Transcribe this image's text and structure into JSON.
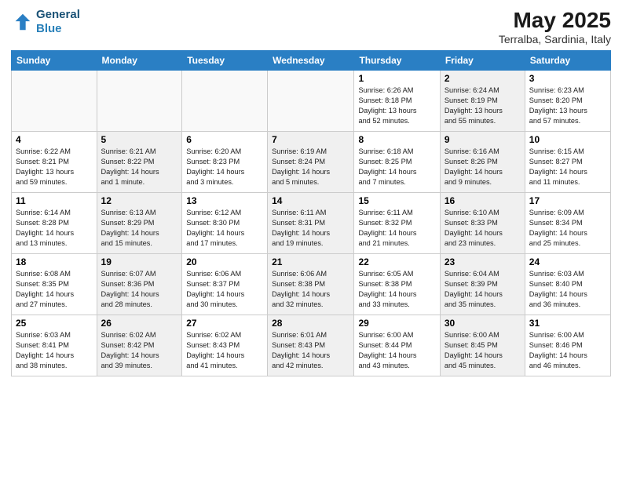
{
  "header": {
    "logo_line1": "General",
    "logo_line2": "Blue",
    "title": "May 2025",
    "subtitle": "Terralba, Sardinia, Italy"
  },
  "days_of_week": [
    "Sunday",
    "Monday",
    "Tuesday",
    "Wednesday",
    "Thursday",
    "Friday",
    "Saturday"
  ],
  "weeks": [
    [
      {
        "day": "",
        "text": "",
        "empty": true
      },
      {
        "day": "",
        "text": "",
        "empty": true
      },
      {
        "day": "",
        "text": "",
        "empty": true
      },
      {
        "day": "",
        "text": "",
        "empty": true
      },
      {
        "day": "1",
        "text": "Sunrise: 6:26 AM\nSunset: 8:18 PM\nDaylight: 13 hours\nand 52 minutes.",
        "shaded": false
      },
      {
        "day": "2",
        "text": "Sunrise: 6:24 AM\nSunset: 8:19 PM\nDaylight: 13 hours\nand 55 minutes.",
        "shaded": true
      },
      {
        "day": "3",
        "text": "Sunrise: 6:23 AM\nSunset: 8:20 PM\nDaylight: 13 hours\nand 57 minutes.",
        "shaded": false
      }
    ],
    [
      {
        "day": "4",
        "text": "Sunrise: 6:22 AM\nSunset: 8:21 PM\nDaylight: 13 hours\nand 59 minutes.",
        "shaded": false
      },
      {
        "day": "5",
        "text": "Sunrise: 6:21 AM\nSunset: 8:22 PM\nDaylight: 14 hours\nand 1 minute.",
        "shaded": true
      },
      {
        "day": "6",
        "text": "Sunrise: 6:20 AM\nSunset: 8:23 PM\nDaylight: 14 hours\nand 3 minutes.",
        "shaded": false
      },
      {
        "day": "7",
        "text": "Sunrise: 6:19 AM\nSunset: 8:24 PM\nDaylight: 14 hours\nand 5 minutes.",
        "shaded": true
      },
      {
        "day": "8",
        "text": "Sunrise: 6:18 AM\nSunset: 8:25 PM\nDaylight: 14 hours\nand 7 minutes.",
        "shaded": false
      },
      {
        "day": "9",
        "text": "Sunrise: 6:16 AM\nSunset: 8:26 PM\nDaylight: 14 hours\nand 9 minutes.",
        "shaded": true
      },
      {
        "day": "10",
        "text": "Sunrise: 6:15 AM\nSunset: 8:27 PM\nDaylight: 14 hours\nand 11 minutes.",
        "shaded": false
      }
    ],
    [
      {
        "day": "11",
        "text": "Sunrise: 6:14 AM\nSunset: 8:28 PM\nDaylight: 14 hours\nand 13 minutes.",
        "shaded": false
      },
      {
        "day": "12",
        "text": "Sunrise: 6:13 AM\nSunset: 8:29 PM\nDaylight: 14 hours\nand 15 minutes.",
        "shaded": true
      },
      {
        "day": "13",
        "text": "Sunrise: 6:12 AM\nSunset: 8:30 PM\nDaylight: 14 hours\nand 17 minutes.",
        "shaded": false
      },
      {
        "day": "14",
        "text": "Sunrise: 6:11 AM\nSunset: 8:31 PM\nDaylight: 14 hours\nand 19 minutes.",
        "shaded": true
      },
      {
        "day": "15",
        "text": "Sunrise: 6:11 AM\nSunset: 8:32 PM\nDaylight: 14 hours\nand 21 minutes.",
        "shaded": false
      },
      {
        "day": "16",
        "text": "Sunrise: 6:10 AM\nSunset: 8:33 PM\nDaylight: 14 hours\nand 23 minutes.",
        "shaded": true
      },
      {
        "day": "17",
        "text": "Sunrise: 6:09 AM\nSunset: 8:34 PM\nDaylight: 14 hours\nand 25 minutes.",
        "shaded": false
      }
    ],
    [
      {
        "day": "18",
        "text": "Sunrise: 6:08 AM\nSunset: 8:35 PM\nDaylight: 14 hours\nand 27 minutes.",
        "shaded": false
      },
      {
        "day": "19",
        "text": "Sunrise: 6:07 AM\nSunset: 8:36 PM\nDaylight: 14 hours\nand 28 minutes.",
        "shaded": true
      },
      {
        "day": "20",
        "text": "Sunrise: 6:06 AM\nSunset: 8:37 PM\nDaylight: 14 hours\nand 30 minutes.",
        "shaded": false
      },
      {
        "day": "21",
        "text": "Sunrise: 6:06 AM\nSunset: 8:38 PM\nDaylight: 14 hours\nand 32 minutes.",
        "shaded": true
      },
      {
        "day": "22",
        "text": "Sunrise: 6:05 AM\nSunset: 8:38 PM\nDaylight: 14 hours\nand 33 minutes.",
        "shaded": false
      },
      {
        "day": "23",
        "text": "Sunrise: 6:04 AM\nSunset: 8:39 PM\nDaylight: 14 hours\nand 35 minutes.",
        "shaded": true
      },
      {
        "day": "24",
        "text": "Sunrise: 6:03 AM\nSunset: 8:40 PM\nDaylight: 14 hours\nand 36 minutes.",
        "shaded": false
      }
    ],
    [
      {
        "day": "25",
        "text": "Sunrise: 6:03 AM\nSunset: 8:41 PM\nDaylight: 14 hours\nand 38 minutes.",
        "shaded": false
      },
      {
        "day": "26",
        "text": "Sunrise: 6:02 AM\nSunset: 8:42 PM\nDaylight: 14 hours\nand 39 minutes.",
        "shaded": true
      },
      {
        "day": "27",
        "text": "Sunrise: 6:02 AM\nSunset: 8:43 PM\nDaylight: 14 hours\nand 41 minutes.",
        "shaded": false
      },
      {
        "day": "28",
        "text": "Sunrise: 6:01 AM\nSunset: 8:43 PM\nDaylight: 14 hours\nand 42 minutes.",
        "shaded": true
      },
      {
        "day": "29",
        "text": "Sunrise: 6:00 AM\nSunset: 8:44 PM\nDaylight: 14 hours\nand 43 minutes.",
        "shaded": false
      },
      {
        "day": "30",
        "text": "Sunrise: 6:00 AM\nSunset: 8:45 PM\nDaylight: 14 hours\nand 45 minutes.",
        "shaded": true
      },
      {
        "day": "31",
        "text": "Sunrise: 6:00 AM\nSunset: 8:46 PM\nDaylight: 14 hours\nand 46 minutes.",
        "shaded": false
      }
    ]
  ]
}
